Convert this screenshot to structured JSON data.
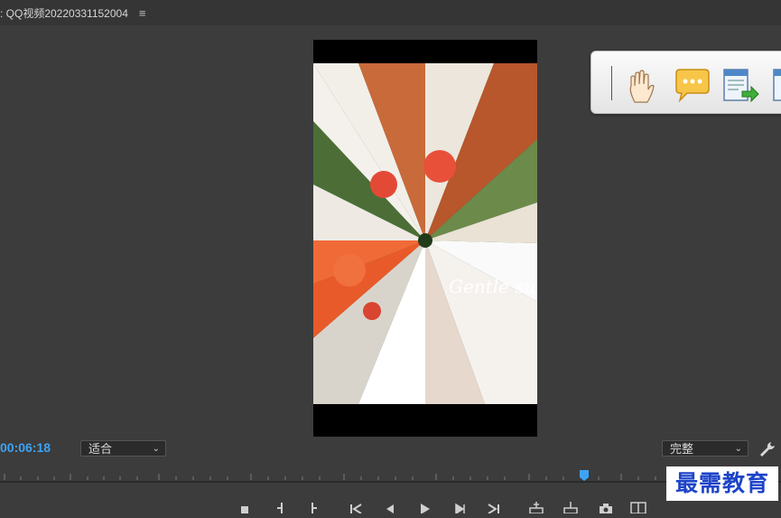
{
  "titlebar": {
    "title": ": QQ视频20220331152004",
    "menu_icon": "hamburger-menu-icon"
  },
  "viewer": {
    "overlay_text": "Gentle su",
    "floating_toolbar": {
      "tools": [
        "hand-icon",
        "comment-icon",
        "export-document-icon",
        "document-icon"
      ]
    }
  },
  "controls": {
    "timecode": "00:06:18",
    "zoom_select": "适合",
    "quality_select": "完整",
    "settings_icon": "wrench-icon"
  },
  "timeline": {
    "playhead_color": "#3da3f5"
  },
  "transport": {
    "buttons": [
      "mark-in-icon",
      "mark-out-icon",
      "mark-out-alt-icon",
      "go-to-in-icon",
      "step-back-icon",
      "play-icon",
      "step-forward-icon",
      "go-to-out-icon",
      "insert-icon",
      "overwrite-icon",
      "export-frame-icon",
      "compare-icon"
    ]
  },
  "watermark": {
    "text": "最需教育"
  }
}
